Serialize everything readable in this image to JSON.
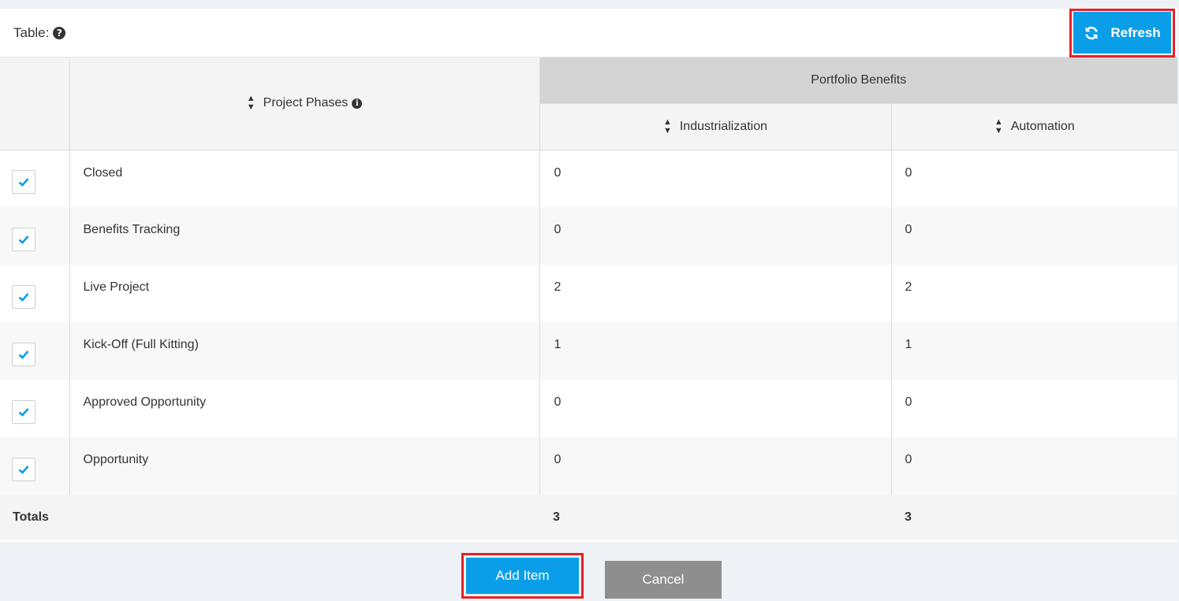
{
  "panel": {
    "title": "Table:",
    "help_icon": "question-circle-icon",
    "refresh_label": "Refresh",
    "refresh_icon": "refresh-icon"
  },
  "table": {
    "phase_header": "Project Phases",
    "group_header": "Portfolio Benefits",
    "columns": [
      "Industrialization",
      "Automation"
    ],
    "rows": [
      {
        "checked": true,
        "phase": "Closed",
        "industrialization": "0",
        "automation": "0"
      },
      {
        "checked": true,
        "phase": "Benefits Tracking",
        "industrialization": "0",
        "automation": "0"
      },
      {
        "checked": true,
        "phase": "Live Project",
        "industrialization": "2",
        "automation": "2"
      },
      {
        "checked": true,
        "phase": "Kick-Off (Full Kitting)",
        "industrialization": "1",
        "automation": "1"
      },
      {
        "checked": true,
        "phase": "Approved Opportunity",
        "industrialization": "0",
        "automation": "0"
      },
      {
        "checked": true,
        "phase": "Opportunity",
        "industrialization": "0",
        "automation": "0"
      }
    ],
    "totals": {
      "label": "Totals",
      "industrialization": "3",
      "automation": "3"
    }
  },
  "footer": {
    "add_label": "Add Item",
    "cancel_label": "Cancel"
  },
  "colors": {
    "primary": "#0a9ee8",
    "highlight": "#e8202a",
    "secondary": "#8e8e8e",
    "header_group": "#d4d4d4"
  }
}
